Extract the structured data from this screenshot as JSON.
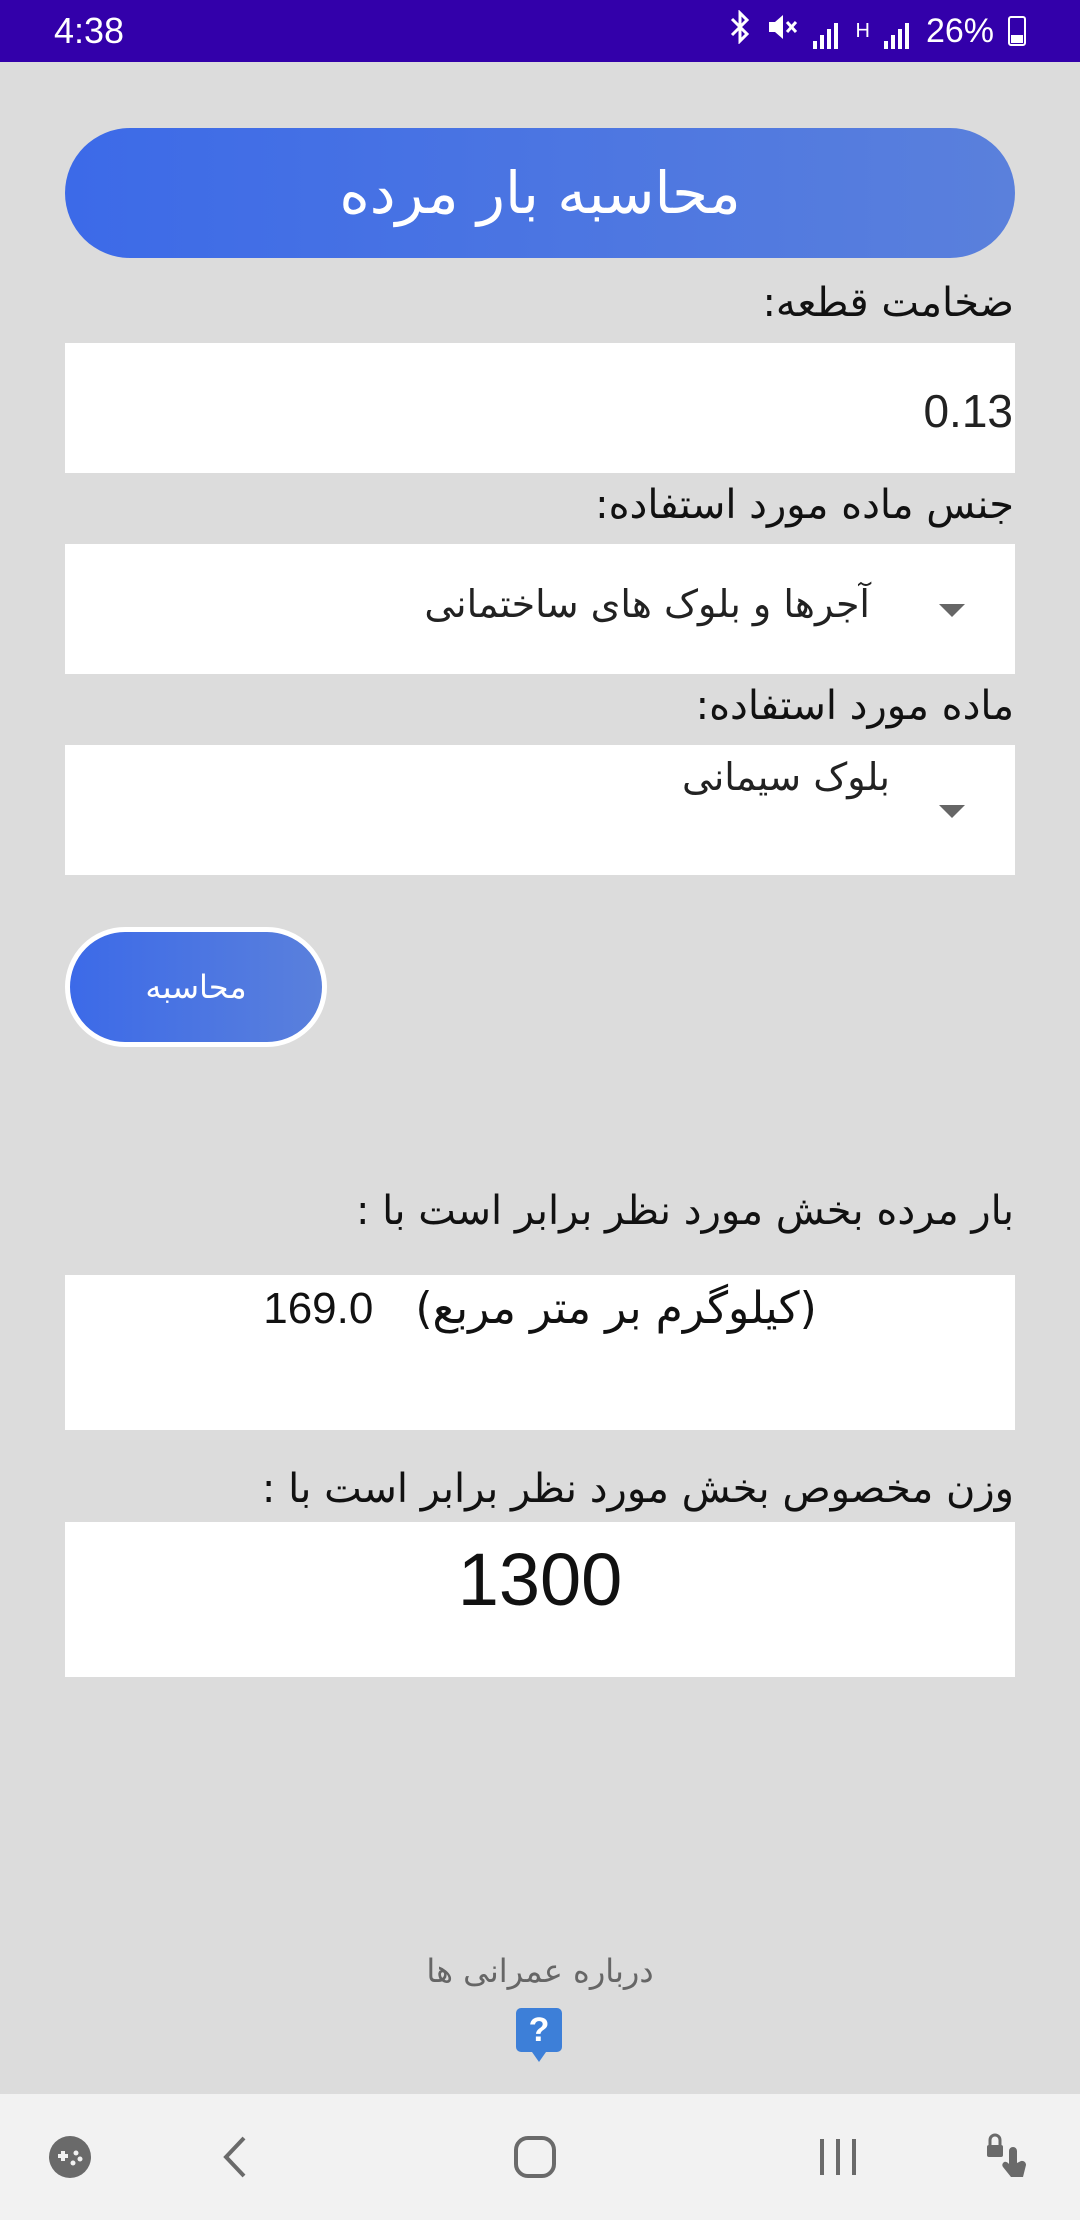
{
  "status_bar": {
    "time": "4:38",
    "battery_percent": "26%",
    "network_h": "H"
  },
  "header": {
    "title": "محاسبه بار مرده"
  },
  "form": {
    "thickness_label": "ضخامت قطعه:",
    "thickness_value": "0.13",
    "material_type_label": "جنس ماده مورد استفاده:",
    "material_type_selected": "آجرها و بلوک های ساختمانی",
    "material_label": "ماده مورد استفاده:",
    "material_selected": "بلوک سیمانی",
    "calculate_label": "محاسبه"
  },
  "results": {
    "dead_load_label": "بار مرده بخش مورد نظر برابر است با :",
    "dead_load_value": "169.0",
    "dead_load_unit": "(کیلوگرم بر متر مربع)",
    "specific_weight_label": "وزن مخصوص بخش مورد نظر برابر است با :",
    "specific_weight_value": "1300"
  },
  "footer": {
    "about_label": "درباره عمرانی ها",
    "help_glyph": "?"
  },
  "nav": {
    "icons": [
      "game-tools-icon",
      "back-icon",
      "home-icon",
      "recents-icon",
      "lock-touch-icon"
    ]
  },
  "colors": {
    "status_bar": "#3300aa",
    "accent": "#3c6ae8",
    "background": "#dcdcdc"
  }
}
